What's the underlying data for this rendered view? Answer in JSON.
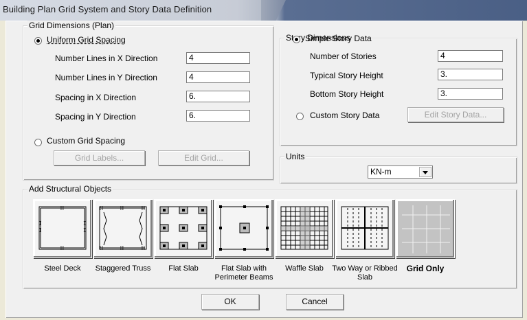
{
  "window": {
    "title": "Building Plan Grid System and Story Data Definition"
  },
  "grid_dimensions": {
    "group_title": "Grid Dimensions (Plan)",
    "uniform_label": "Uniform Grid Spacing",
    "uniform_selected": true,
    "fields": [
      {
        "label": "Number Lines in X Direction",
        "value": "4"
      },
      {
        "label": "Number Lines in Y Direction",
        "value": "4"
      },
      {
        "label": "Spacing in X Direction",
        "value": "6."
      },
      {
        "label": "Spacing in Y Direction",
        "value": "6."
      }
    ],
    "custom_label": "Custom Grid Spacing",
    "custom_selected": false,
    "grid_labels_button": "Grid Labels...",
    "edit_grid_button": "Edit Grid..."
  },
  "story_dimensions": {
    "group_title": "Story Dimensions",
    "simple_label": "Simple Story Data",
    "simple_selected": true,
    "fields": [
      {
        "label": "Number of Stories",
        "value": "4"
      },
      {
        "label": "Typical Story Height",
        "value": "3."
      },
      {
        "label": "Bottom Story Height",
        "value": "3."
      }
    ],
    "custom_label": "Custom Story Data",
    "custom_selected": false,
    "edit_story_button": "Edit Story Data..."
  },
  "units": {
    "group_title": "Units",
    "selected": "KN-m"
  },
  "structural_objects": {
    "group_title": "Add Structural Objects",
    "items": [
      {
        "label": "Steel Deck",
        "icon": "steel-deck-icon"
      },
      {
        "label": "Staggered Truss",
        "icon": "staggered-truss-icon"
      },
      {
        "label": "Flat Slab",
        "icon": "flat-slab-icon"
      },
      {
        "label": "Flat Slab with Perimeter Beams",
        "icon": "flat-slab-perimeter-icon"
      },
      {
        "label": "Waffle Slab",
        "icon": "waffle-slab-icon"
      },
      {
        "label": "Two Way or Ribbed Slab",
        "icon": "ribbed-slab-icon"
      },
      {
        "label": "Grid Only",
        "icon": "grid-only-icon",
        "selected": true
      }
    ]
  },
  "buttons": {
    "ok": "OK",
    "cancel": "Cancel"
  }
}
